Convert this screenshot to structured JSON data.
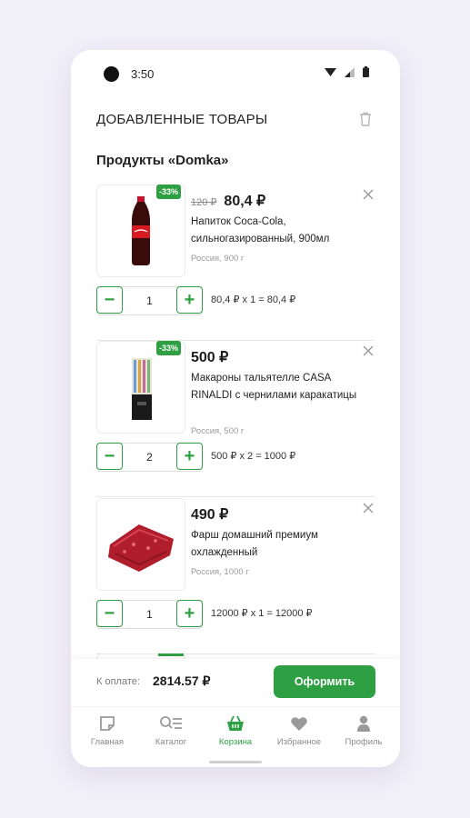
{
  "status_bar": {
    "time": "3:50"
  },
  "header": {
    "title": "ДОБАВЛЕННЫЕ ТОВАРЫ"
  },
  "store": {
    "title": "Продукты «Domka»"
  },
  "items": [
    {
      "discount": "-33%",
      "old_price": "120 ₽",
      "price": "80,4 ₽",
      "name": "Напиток Coca-Cola, сильногазированный, 900мл",
      "origin": "Россия, 900 г",
      "quantity": "1",
      "calc": "80,4 ₽ x 1 = 80,4 ₽"
    },
    {
      "discount": "-33%",
      "price": "500 ₽",
      "name": "Макароны тальятелле CASA RINALDI с чернилами каракатицы",
      "origin": "Россия, 500 г",
      "quantity": "2",
      "calc": "500 ₽ x 2 = 1000 ₽"
    },
    {
      "price": "490 ₽",
      "name": "Фарш домашний премиум охлажденный",
      "origin": "Россия, 1000 г",
      "quantity": "1",
      "calc": "12000 ₽ x 1 = 12000 ₽"
    }
  ],
  "checkout": {
    "label": "К оплате:",
    "total": "2814.57 ₽",
    "button": "Оформить"
  },
  "tabs": [
    {
      "label": "Главная",
      "icon": "home-icon"
    },
    {
      "label": "Каталог",
      "icon": "catalog-icon"
    },
    {
      "label": "Корзина",
      "icon": "basket-icon",
      "active": true
    },
    {
      "label": "Избранное",
      "icon": "heart-icon"
    },
    {
      "label": "Профиль",
      "icon": "profile-icon"
    }
  ],
  "colors": {
    "accent": "#2ea043",
    "background": "#f1eff8"
  }
}
